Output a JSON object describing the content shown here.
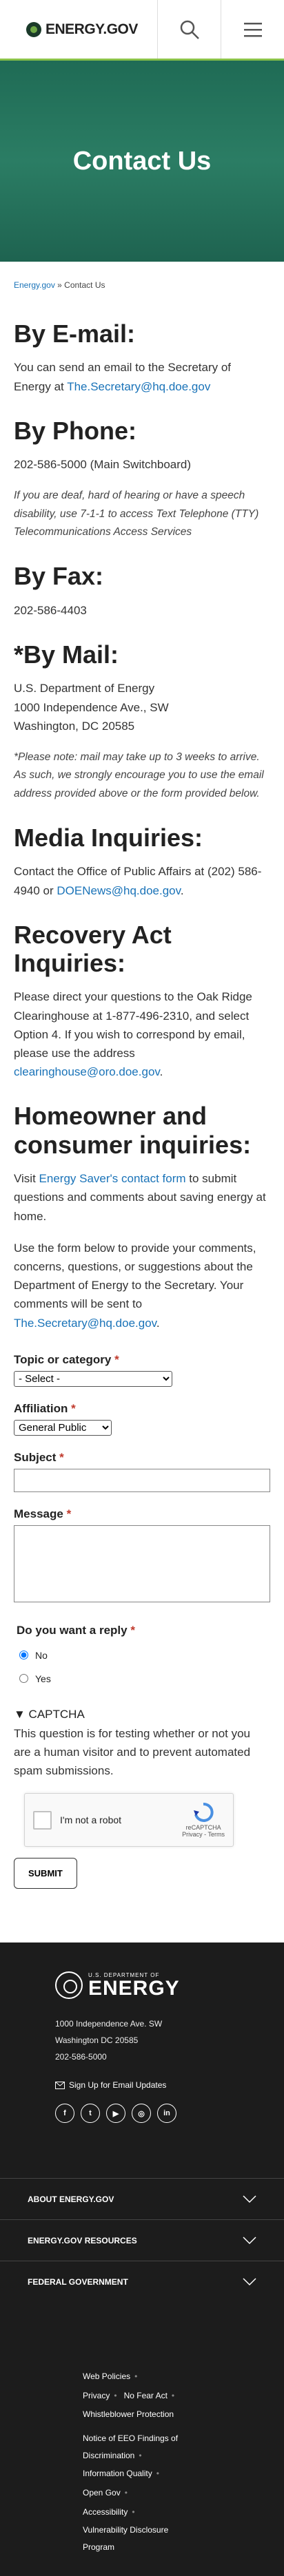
{
  "header": {
    "logo_text": "ENERGY.GOV",
    "search_icon": "search-icon",
    "menu_icon": "hamburger-icon"
  },
  "hero": {
    "title": "Contact Us"
  },
  "breadcrumb": {
    "home": "Energy.gov",
    "separator": " » ",
    "current": "Contact Us"
  },
  "email": {
    "heading": "By E-mail:",
    "text": "You can send an email to the Secretary of Energy at ",
    "link": "The.Secretary@hq.doe.gov"
  },
  "phone": {
    "heading": "By Phone:",
    "number": "202-586-5000 (Main Switchboard)",
    "tty": "If you are deaf, hard of hearing or have a speech disability, use 7-1-1 to access Text Telephone (TTY) Telecommunications Access Services"
  },
  "fax": {
    "heading": "By Fax:",
    "number": "202-586-4403"
  },
  "mail": {
    "heading": "*By Mail:",
    "line1": "U.S. Department of Energy",
    "line2": "1000 Independence Ave., SW",
    "line3": "Washington, DC 20585",
    "note": "*Please note: mail may take up to 3 weeks to arrive.  As such, we strongly encourage you to use the email address provided above or the form provided below."
  },
  "media": {
    "heading": "Media Inquiries:",
    "text": "Contact the Office of Public Affairs at (202) 586-4940 or ",
    "link": "DOENews@hq.doe.gov",
    "end": "."
  },
  "recovery": {
    "heading": "Recovery Act Inquiries:",
    "text": "Please direct your questions to the Oak Ridge Clearinghouse at 1-877-496-2310, and select Option 4. If you wish to correspond by email, please use the address ",
    "link": "clearinghouse@oro.doe.gov",
    "end": "."
  },
  "homeowner": {
    "heading": "Homeowner and consumer inquiries:",
    "p1_pre": "Visit ",
    "p1_link": "Energy Saver's contact form",
    "p1_post": " to submit questions and comments about saving energy at home.",
    "p2_pre": "Use the form below to provide your comments, concerns, questions, or suggestions about the Department of Energy to the Secretary. Your comments will be sent to ",
    "p2_link": "The.Secretary@hq.doe.gov",
    "p2_post": "."
  },
  "form": {
    "topic_label": "Topic or category",
    "topic_value": "- Select -",
    "affiliation_label": "Affiliation",
    "affiliation_value": "General Public",
    "subject_label": "Subject",
    "message_label": "Message",
    "reply_label": "Do you want a reply",
    "reply_no": "No",
    "reply_yes": "Yes",
    "required_mark": "*",
    "captcha_heading": "▼ CAPTCHA",
    "captcha_text": "This question is for testing whether or not you are a human visitor and to prevent automated spam submissions.",
    "captcha_checkbox": "I'm not a robot",
    "captcha_brand": "reCAPTCHA",
    "captcha_terms": "Privacy - Terms",
    "submit_label": "SUBMIT"
  },
  "footer": {
    "dept_small": "U.S. DEPARTMENT OF",
    "dept_big": "ENERGY",
    "addr1": "1000 Independence Ave. SW",
    "addr2": "Washington DC 20585",
    "phone": "202-586-5000",
    "signup": "Sign Up for Email Updates",
    "social": [
      "f",
      "t",
      "▶",
      "◎",
      "in"
    ],
    "accordions": [
      "ABOUT ENERGY.GOV",
      "ENERGY.GOV RESOURCES",
      "FEDERAL GOVERNMENT"
    ],
    "links": [
      "Web Policies",
      "Privacy",
      "No Fear Act",
      "Whistleblower Protection",
      "Notice of EEO Findings of Discrimination",
      "Information Quality",
      "Open Gov",
      "Accessibility",
      "Vulnerability Disclosure Program"
    ]
  }
}
